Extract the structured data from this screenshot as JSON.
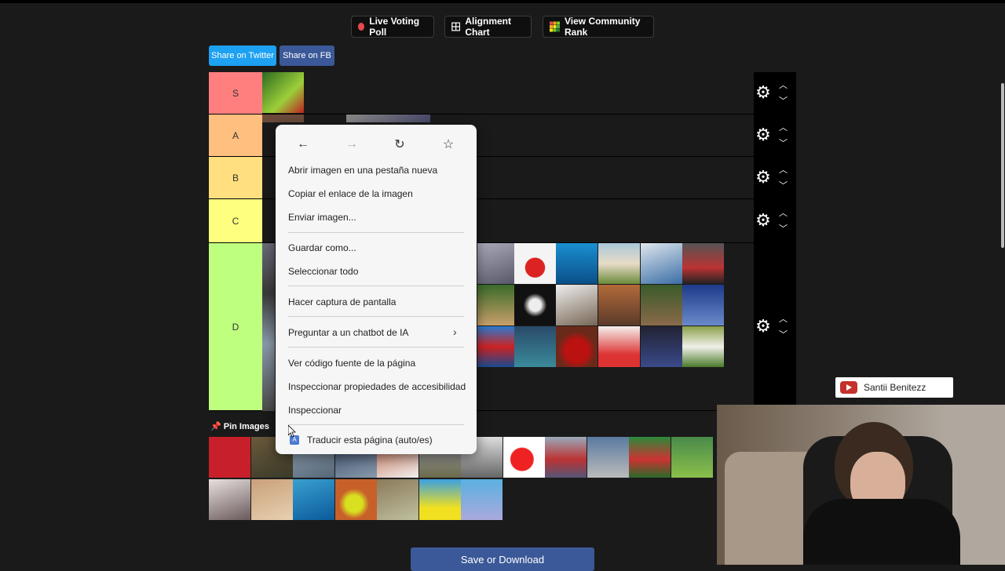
{
  "toolbar": {
    "live_voting": "Live Voting Poll",
    "alignment_chart": "Alignment Chart",
    "community_rank": "View Community Rank",
    "share_twitter": "Share on Twitter",
    "share_fb": "Share on FB"
  },
  "tiers": [
    {
      "label": "S",
      "color": "#ff7f7f"
    },
    {
      "label": "A",
      "color": "#ffbf7f"
    },
    {
      "label": "B",
      "color": "#ffdf7f"
    },
    {
      "label": "C",
      "color": "#ffff7f"
    },
    {
      "label": "D",
      "color": "#bfff7f"
    }
  ],
  "context_menu": {
    "items": [
      "Abrir imagen en una pestaña nueva",
      "Copiar el enlace de la imagen",
      "Enviar imagen...",
      "Guardar como...",
      "Seleccionar todo",
      "Hacer captura de pantalla",
      "Preguntar a un chatbot de IA",
      "Ver código fuente de la página",
      "Inspeccionar propiedades de accesibilidad",
      "Inspeccionar",
      "Traducir esta página (auto/es)"
    ]
  },
  "pin_images_label": "Pin Images",
  "save_label": "Save or Download",
  "streamer": {
    "name": "Santii Benitezz"
  },
  "icons": [
    "gear-icon",
    "chevron-up-icon",
    "chevron-down-icon",
    "back-arrow-icon",
    "forward-arrow-icon",
    "reload-icon",
    "bookmark-star-icon",
    "grid-icon",
    "pin-icon",
    "youtube-icon"
  ]
}
